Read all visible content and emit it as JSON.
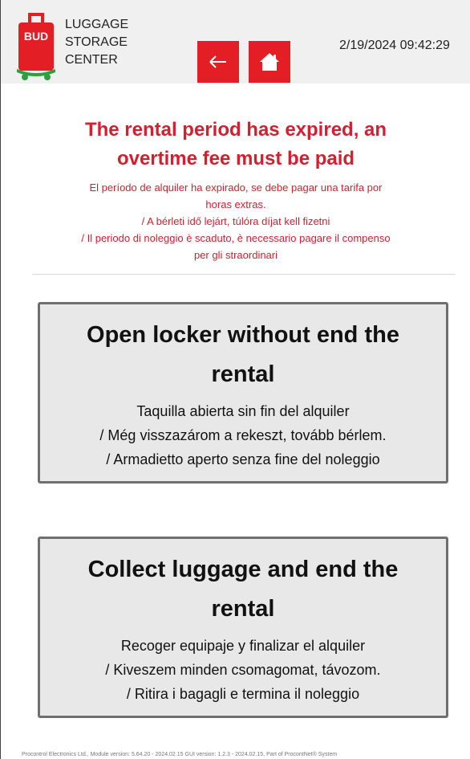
{
  "header": {
    "logo_text": "BUD",
    "brand_lines": [
      "LUGGAGE",
      "STORAGE",
      "CENTER"
    ],
    "back_icon": "arrow-left-icon",
    "home_icon": "home-icon",
    "datetime": "2/19/2024 09:42:29"
  },
  "notice": {
    "title_line1": "The rental period has expired, an",
    "title_line2": "overtime fee must be paid",
    "sub_lines": [
      "El período de alquiler ha expirado, se debe pagar una tarifa por",
      "horas extras.",
      "/ A bérleti idő lejárt, túlóra díjat kell fizetni",
      "/ Il periodo di noleggio è scaduto, è necessario pagare il compenso",
      "per gli straordinari"
    ]
  },
  "actions": [
    {
      "title_line1": "Open locker without end the",
      "title_line2": "rental",
      "sub_lines": [
        "Taquilla abierta sin fin del alquiler",
        "/ Még visszazárom a rekeszt, tovább bérlem.",
        "/ Armadietto aperto senza fine del noleggio"
      ]
    },
    {
      "title_line1": "Collect luggage and end the",
      "title_line2": "rental",
      "sub_lines": [
        "Recoger equipaje y finalizar el alquiler",
        "/ Kiveszem minden csomagomat, távozom.",
        "/ Ritira i bagagli e termina il noleggio"
      ]
    }
  ],
  "footer": {
    "text": "Procontrol Electronics Ltd., Module version: 5.64.20 - 2024.02.15 GUI version: 1.2.3 - 2024.02.15, Part of ProcontNet® System"
  },
  "colors": {
    "accent_red": "#e31e24",
    "notice_red": "#d32030",
    "logo_green": "#2e9e3e",
    "button_bg": "#e8e8e8",
    "button_border": "#6f6f6f"
  }
}
